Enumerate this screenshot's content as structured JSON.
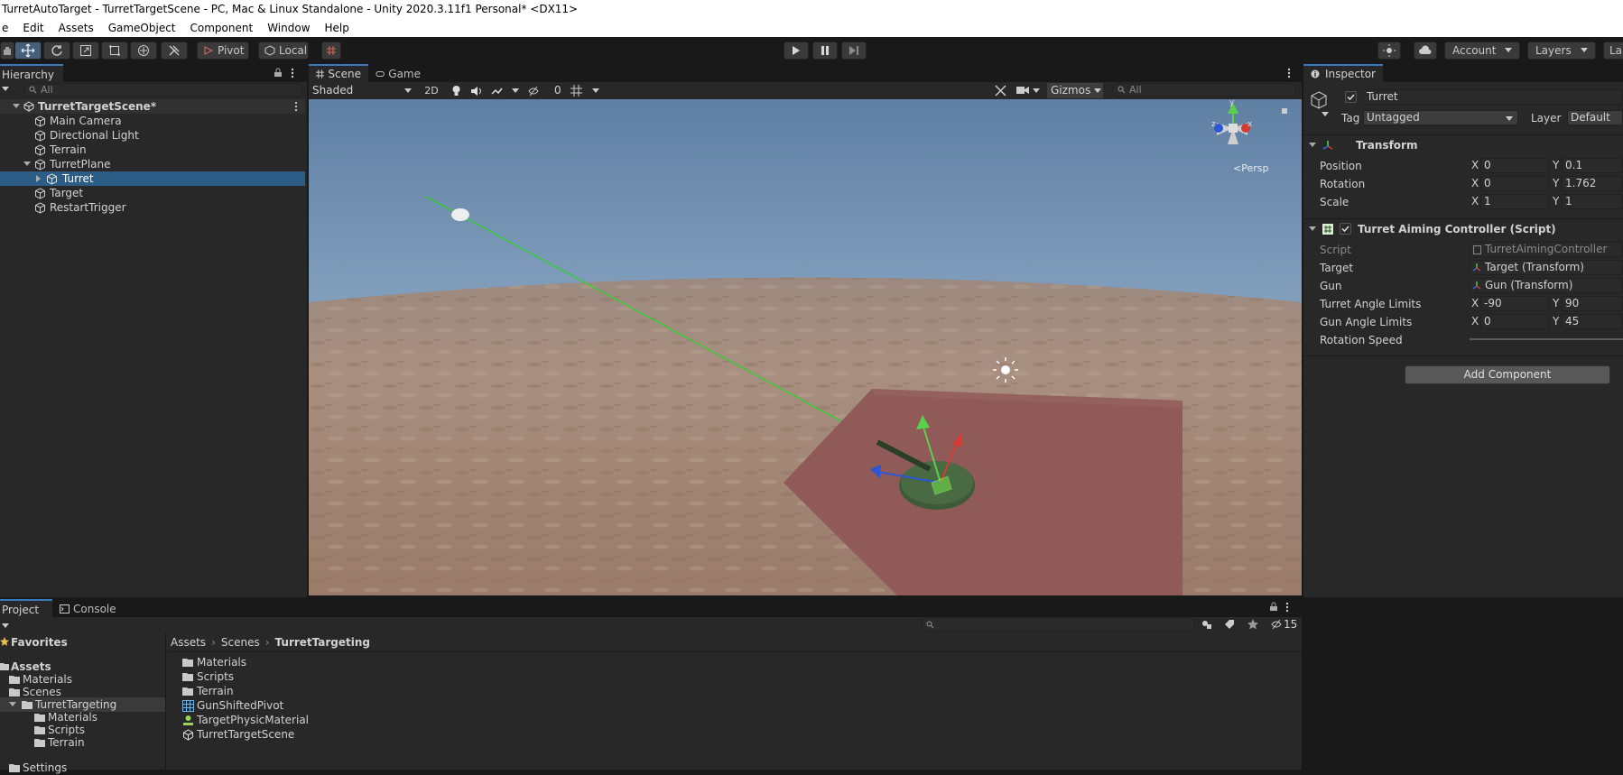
{
  "window": {
    "title": "TurretAutoTarget - TurretTargetScene - PC, Mac & Linux Standalone - Unity 2020.3.11f1 Personal* <DX11>"
  },
  "menu": [
    "e",
    "Edit",
    "Assets",
    "GameObject",
    "Component",
    "Window",
    "Help"
  ],
  "toolbar": {
    "pivot": "Pivot",
    "local": "Local",
    "account": "Account",
    "layers": "Layers",
    "layout": "La"
  },
  "hierarchy": {
    "tab": "Hierarchy",
    "search_placeholder": "All",
    "scene": "TurretTargetScene*",
    "items": [
      "Main Camera",
      "Directional Light",
      "Terrain",
      "TurretPlane",
      "Turret",
      "Target",
      "RestartTrigger"
    ],
    "selected": "Turret"
  },
  "scene": {
    "tab_scene": "Scene",
    "tab_game": "Game",
    "shading": "Shaded",
    "mode_2d": "2D",
    "hidden_count": "0",
    "gizmos": "Gizmos",
    "search_placeholder": "All",
    "persp": "<Persp"
  },
  "inspector": {
    "tab": "Inspector",
    "object_name": "Turret",
    "tag_label": "Tag",
    "tag_value": "Untagged",
    "layer_label": "Layer",
    "layer_value": "Default",
    "transform": {
      "title": "Transform",
      "position": {
        "label": "Position",
        "x": "0",
        "y": "0.1"
      },
      "rotation": {
        "label": "Rotation",
        "x": "0",
        "y": "1.762"
      },
      "scale": {
        "label": "Scale",
        "x": "1",
        "y": "1"
      }
    },
    "script": {
      "title": "Turret Aiming Controller (Script)",
      "script_label": "Script",
      "script_value": "TurretAimingController",
      "target_label": "Target",
      "target_value": "Target (Transform)",
      "gun_label": "Gun",
      "gun_value": "Gun (Transform)",
      "turret_limits": {
        "label": "Turret Angle Limits",
        "x": "-90",
        "y": "90"
      },
      "gun_limits": {
        "label": "Gun Angle Limits",
        "x": "0",
        "y": "45"
      },
      "rotation_speed_label": "Rotation Speed"
    },
    "add_component": "Add Component",
    "axis_x": "X",
    "axis_y": "Y"
  },
  "project": {
    "tab_project": "Project",
    "tab_console": "Console",
    "favorites": "Favorites",
    "tree": [
      "Assets",
      "Materials",
      "Scenes",
      "TurretTargeting",
      "Materials",
      "Scripts",
      "Terrain",
      "Settings"
    ],
    "breadcrumb": [
      "Assets",
      "Scenes",
      "TurretTargeting"
    ],
    "assets": [
      "Materials",
      "Scripts",
      "Terrain",
      "GunShiftedPivot",
      "TargetPhysicMaterial",
      "TurretTargetScene"
    ],
    "hidden_count": "15"
  },
  "colors": {
    "accent": "#3a79bb",
    "selection": "#2c5d87",
    "panel": "#282828",
    "plane": "#8f5a58"
  }
}
